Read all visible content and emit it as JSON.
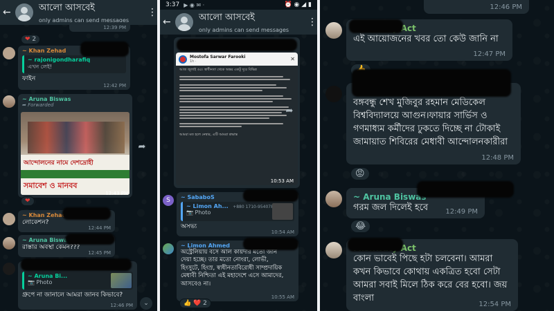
{
  "panel1": {
    "header": {
      "back_icon": "arrow-back-icon",
      "title": "আলো আসবেই",
      "subtitle": "only admins can send messages",
      "menu_icon": "more-vert-icon"
    },
    "top_time": "12:39 PM",
    "top_reaction": "2",
    "msg1": {
      "sender": "~ Khan Zehad",
      "quote_name": "~ rajonigondharafiq",
      "quote_text": "এখন লেই!",
      "text": "ফাইন",
      "time": "12:42 PM"
    },
    "msg2": {
      "sender": "~ Aruna Biswas",
      "forwarded": "Forwarded",
      "banner_line1": "আন্দোলনের নামে দেশদ্রোহী",
      "banner_line2": "সমাবেশ ও মানবব",
      "time": "12:43 PM"
    },
    "msg3": {
      "sender": "~ Khan Zehad",
      "text": "লোকেশন?",
      "time": "12:44 PM"
    },
    "msg4": {
      "sender": "~ Aruna Biswas",
      "text": "রাস্তার অবস্থা কেমন???",
      "time": "12:45 PM"
    },
    "msg5": {
      "quote_name": "~ Aruna Bi...",
      "quote_text": "Photo",
      "text": "গ্রুপে না জানালে আমরা জানব কিভাবে?",
      "time": "12:46 PM"
    }
  },
  "panel2": {
    "status": {
      "time": "3:37",
      "right_icons": "⏰ ◉ ◢ ▮"
    },
    "header": {
      "back_icon": "arrow-back-icon",
      "title": "আলো আসবেই",
      "subtitle": "only admins can send messages",
      "menu_icon": "more-vert-icon"
    },
    "post": {
      "author": "Mostofa Sarwar Farooki",
      "meta": "1h · ",
      "first_line": "আজ জুলাই ও৫। স্বাধীনতা থেকে অন্তর একটু দূরে বিভিন্ন",
      "last_line": "আমরা মত হলে নেম্বার, এটি আমরা শ্রদ্ধান্ত",
      "time": "10:53 AM"
    },
    "msg1": {
      "sender": "~ SababoS",
      "quote_name": "~ Limon Ah...",
      "quote_phone": "+880 1710-954078",
      "quote_text": "Photo",
      "text": "অসভ্য",
      "time": "10:54 AM"
    },
    "msg2": {
      "sender": "~ Limon Ahmed",
      "text": "অস্ট্রেলিয়ায় বসে আল কায়দার মতো জান দেয়া হচ্ছে। তার মতো নোংরা, লোভী, হিংসুটে, হিংস্র, স্বাধীনতাবিরোধী সাম্প্রদায়িক মেধাবী নিশ্চিতা এই মহাদেশে এসে আমাদের, আসবেও না।",
      "time": "10:55 AM",
      "reactions": "👍 ❤️ 2"
    }
  },
  "panel3": {
    "top_time": "12:46 PM",
    "msg1": {
      "sender": "Mishwaty Act",
      "text": "এই আয়োজনের খবর তো কেউ জানি না",
      "time": "12:47 PM",
      "reaction": "👍"
    },
    "msg2": {
      "sender": "~ ",
      "text": "বঙ্গবন্ধু শেখ মুজিবুর রহমান মেডিকেল বিশ্ববিদ্যালয়ে আগুন।ফায়ার সার্ভিস ও গণমাধ্যম কর্মীদের ঢুকতে দিচ্ছে না টোকাই জামায়াত শিবিরের মেধাবী আন্দোলনকারীরা",
      "time": "12:48 PM",
      "reaction": "😡"
    },
    "msg3": {
      "sender": "~ Aruna Biswas",
      "text": "গরম জল দিলেই হবে",
      "time": "12:49 PM",
      "reaction": "😂"
    },
    "msg4": {
      "sender": "Mishwaty Act",
      "text": "কোন ভাবেই পিছে হটা চলবেনা। আমরা কখন কিভাবে কোথায় একত্রিত হবো সেটা আমরা সবাই মিলে ঠিক করে বের হবো। জয় বাংলা",
      "time": "12:54 PM"
    }
  },
  "colors": {
    "bg": "#0b141a",
    "bubble": "#202c33",
    "header": "#1f2c33",
    "khan": "#d98a3a",
    "aruna": "#4fc3a1",
    "limon": "#53a6f5",
    "sababos": "#53a6f5",
    "act": "#7cc36b"
  }
}
